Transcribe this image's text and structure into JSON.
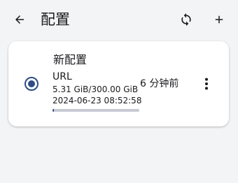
{
  "app_bar": {
    "title": "配置",
    "back_icon": "arrow-left-icon",
    "refresh_icon": "sync-icon",
    "add_icon": "plus-icon"
  },
  "profile_group": {
    "name": "新配置",
    "profiles": [
      {
        "name": "URL",
        "usage": "5.31 GiB/300.00 GiB",
        "expire": "2024-06-23 08:52:58",
        "updated": "6 分钟前",
        "usage_fraction": 0.0177,
        "selected": true,
        "radio_icon": "radio-selected-icon",
        "more_icon": "more-vertical-icon"
      }
    ]
  },
  "colors": {
    "accent": "#2e4d86",
    "track": "#c7cad3",
    "background": "#f3f4f6",
    "card": "#ffffff"
  }
}
